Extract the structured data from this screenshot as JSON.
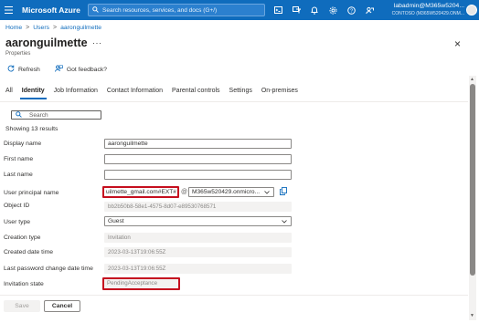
{
  "topbar": {
    "brand": "Microsoft Azure",
    "search_placeholder": "Search resources, services, and docs (G+/)",
    "icons": [
      "cloud-shell-icon",
      "directory-filter-icon",
      "bell-icon",
      "gear-icon",
      "help-icon",
      "feedback-icon"
    ],
    "account_user": "labadmin@M365w5204...",
    "account_tenant": "CONTOSO (M365W520429.ONM..."
  },
  "breadcrumb": {
    "items": [
      "Home",
      "Users",
      "aaronguilmette"
    ],
    "separator": ">"
  },
  "header": {
    "title": "aaronguilmette",
    "more": "···",
    "subtitle": "Properties",
    "close": "×"
  },
  "commands": {
    "refresh": "Refresh",
    "feedback": "Got feedback?"
  },
  "tabs": [
    {
      "label": "All",
      "active": false
    },
    {
      "label": "Identity",
      "active": true
    },
    {
      "label": "Job Information",
      "active": false
    },
    {
      "label": "Contact Information",
      "active": false
    },
    {
      "label": "Parental controls",
      "active": false
    },
    {
      "label": "Settings",
      "active": false
    },
    {
      "label": "On-premises",
      "active": false
    }
  ],
  "filter": {
    "placeholder": "Search",
    "results": "Showing 13 results"
  },
  "fields": {
    "display_name": {
      "label": "Display name",
      "value": "aaronguilmette"
    },
    "first_name": {
      "label": "First name",
      "value": ""
    },
    "last_name": {
      "label": "Last name",
      "value": ""
    },
    "upn": {
      "label": "User principal name",
      "value": "uilmette_gmail.com#EXT#",
      "at": "@",
      "domain": "M365w520429.onmicro..."
    },
    "object_id": {
      "label": "Object ID",
      "value": "bb2b50b8-58e1-4575-8d07-e89530768571"
    },
    "user_type": {
      "label": "User type",
      "value": "Guest"
    },
    "creation_type": {
      "label": "Creation type",
      "value": "Invitation"
    },
    "created_date": {
      "label": "Created date time",
      "value": "2023-03-13T19:06:55Z"
    },
    "last_password_change": {
      "label": "Last password change date time",
      "value": "2023-03-13T19:06:55Z"
    },
    "invitation_state": {
      "label": "Invitation state",
      "value": "PendingAcceptance"
    }
  },
  "footer": {
    "save": "Save",
    "cancel": "Cancel"
  },
  "colors": {
    "brand": "#0f6cbd",
    "highlight": "#c50f1f",
    "readonly_bg": "#f3f2f1"
  }
}
